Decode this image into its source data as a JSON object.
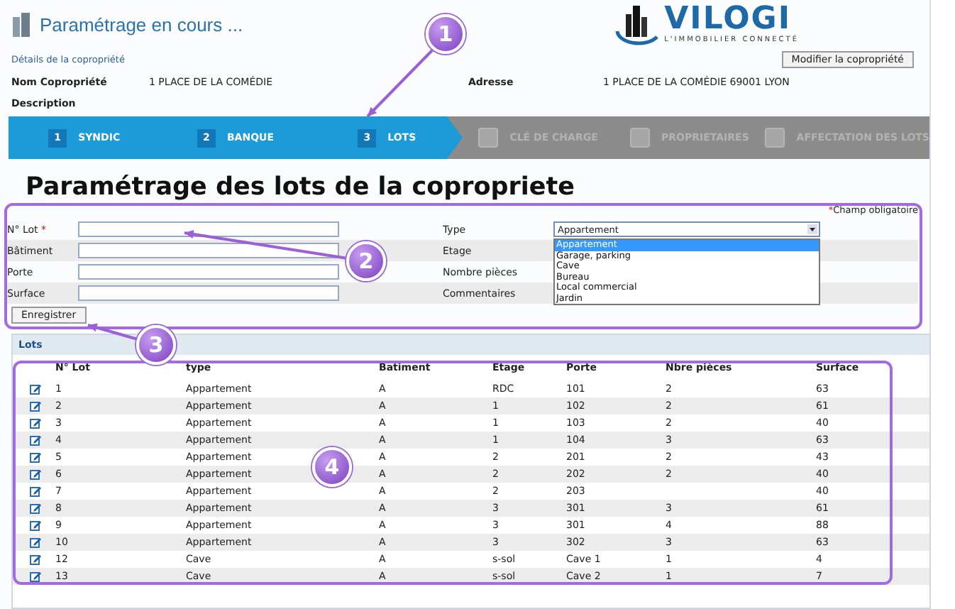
{
  "header": {
    "title": "Paramétrage en cours ..."
  },
  "logo": {
    "name": "VILOGI",
    "tagline": "L'IMMOBILIER CONNECTÉ"
  },
  "details": {
    "link": "Détails de la copropriété",
    "edit_button": "Modifier la copropriété",
    "fields": [
      {
        "label": "Nom Copropriété",
        "value": "1 PLACE DE LA COMÉDIE"
      },
      {
        "label": "Adresse",
        "value": "1 PLACE DE LA COMÉDIE 69001 LYON"
      }
    ],
    "description_label": "Description"
  },
  "steps": [
    {
      "number": "1",
      "label": "SYNDIC",
      "done": true
    },
    {
      "number": "2",
      "label": "BANQUE",
      "done": true
    },
    {
      "number": "3",
      "label": "LOTS",
      "done": true
    },
    {
      "label": "CLÉ DE CHARGE",
      "done": false
    },
    {
      "label": "PROPRIETAIRES",
      "done": false
    },
    {
      "label": "AFFECTATION DES LOTS",
      "done": false
    }
  ],
  "form": {
    "heading": "Paramétrage des lots de la copropriete",
    "required_mark": "*",
    "required_note": "Champ obligatoire",
    "left_fields": [
      {
        "label": "N° Lot",
        "required": true
      },
      {
        "label": "Bâtiment",
        "required": false
      },
      {
        "label": "Porte",
        "required": false
      },
      {
        "label": "Surface",
        "required": false
      }
    ],
    "right_fields": [
      {
        "label": "Type"
      },
      {
        "label": "Etage"
      },
      {
        "label": "Nombre pièces"
      },
      {
        "label": "Commentaires"
      }
    ],
    "type_select": {
      "value": "Appartement",
      "options": [
        {
          "label": "Appartement",
          "selected": true
        },
        {
          "label": "Garage, parking",
          "selected": false
        },
        {
          "label": "Cave",
          "selected": false
        },
        {
          "label": "Bureau",
          "selected": false
        },
        {
          "label": "Local commercial",
          "selected": false
        },
        {
          "label": "Jardin",
          "selected": false
        }
      ]
    },
    "save_button": "Enregistrer"
  },
  "lots": {
    "title": "Lots",
    "columns": [
      "N° Lot",
      "type",
      "Batiment",
      "Etage",
      "Porte",
      "Nbre pièces",
      "Surface"
    ],
    "rows": [
      {
        "lot": "1",
        "type": "Appartement",
        "batiment": "A",
        "etage": "RDC",
        "porte": "101",
        "pieces": "2",
        "surface": "63"
      },
      {
        "lot": "2",
        "type": "Appartement",
        "batiment": "A",
        "etage": "1",
        "porte": "102",
        "pieces": "2",
        "surface": "61"
      },
      {
        "lot": "3",
        "type": "Appartement",
        "batiment": "A",
        "etage": "1",
        "porte": "103",
        "pieces": "2",
        "surface": "40"
      },
      {
        "lot": "4",
        "type": "Appartement",
        "batiment": "A",
        "etage": "1",
        "porte": "104",
        "pieces": "3",
        "surface": "63"
      },
      {
        "lot": "5",
        "type": "Appartement",
        "batiment": "A",
        "etage": "2",
        "porte": "201",
        "pieces": "2",
        "surface": "43"
      },
      {
        "lot": "6",
        "type": "Appartement",
        "batiment": "A",
        "etage": "2",
        "porte": "202",
        "pieces": "2",
        "surface": "40"
      },
      {
        "lot": "7",
        "type": "Appartement",
        "batiment": "A",
        "etage": "2",
        "porte": "203",
        "surface": "40"
      },
      {
        "lot": "8",
        "type": "Appartement",
        "batiment": "A",
        "etage": "3",
        "porte": "301",
        "pieces": "3",
        "surface": "61"
      },
      {
        "lot": "9",
        "type": "Appartement",
        "batiment": "A",
        "etage": "3",
        "porte": "301",
        "pieces": "4",
        "surface": "88"
      },
      {
        "lot": "10",
        "type": "Appartement",
        "batiment": "A",
        "etage": "3",
        "porte": "302",
        "pieces": "3",
        "surface": "63"
      },
      {
        "lot": "12",
        "type": "Cave",
        "batiment": "A",
        "etage": "s-sol",
        "porte": "Cave 1",
        "pieces": "1",
        "surface": "4"
      },
      {
        "lot": "13",
        "type": "Cave",
        "batiment": "A",
        "etage": "s-sol",
        "porte": "Cave 2",
        "pieces": "1",
        "surface": "7"
      }
    ]
  },
  "callouts": [
    {
      "label": "1"
    },
    {
      "label": "2"
    },
    {
      "label": "3"
    },
    {
      "label": "4"
    }
  ]
}
